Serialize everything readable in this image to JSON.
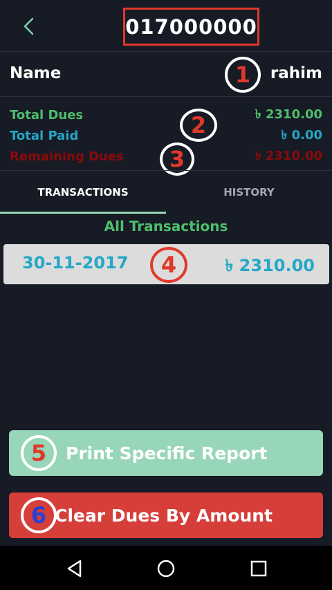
{
  "header": {
    "title": "017000000"
  },
  "customer": {
    "name_label": "Name",
    "name_value": "rahim"
  },
  "summary": {
    "total_dues_label": "Total Dues",
    "total_dues_value": "৳ 2310.00",
    "total_paid_label": "Total Paid",
    "total_paid_value": "৳ 0.00",
    "remaining_label": "Remaining Dues",
    "remaining_value": "৳ 2310.00"
  },
  "tabs": [
    {
      "label": "TRANSACTIONS",
      "active": true
    },
    {
      "label": "HISTORY",
      "active": false
    }
  ],
  "section_title": "All Transactions",
  "transactions": [
    {
      "date": "30-11-2017",
      "amount": "৳ 2310.00"
    }
  ],
  "buttons": {
    "print_label": "Print Specific Report",
    "clear_label": "Clear Dues By Amount"
  },
  "badges": [
    "1",
    "2",
    "3",
    "4",
    "5",
    "6"
  ],
  "colors": {
    "background": "#161b25",
    "green": "#4fbe6c",
    "blue": "#25a7c6",
    "dark_red": "#8b0a0a",
    "mint": "#97d6b8",
    "red": "#d63e3a",
    "annotation_red": "#e0392b"
  },
  "icons": {
    "back": "chevron-left-icon",
    "nav_back": "triangle-back-icon",
    "nav_home": "circle-home-icon",
    "nav_recents": "square-recents-icon"
  }
}
